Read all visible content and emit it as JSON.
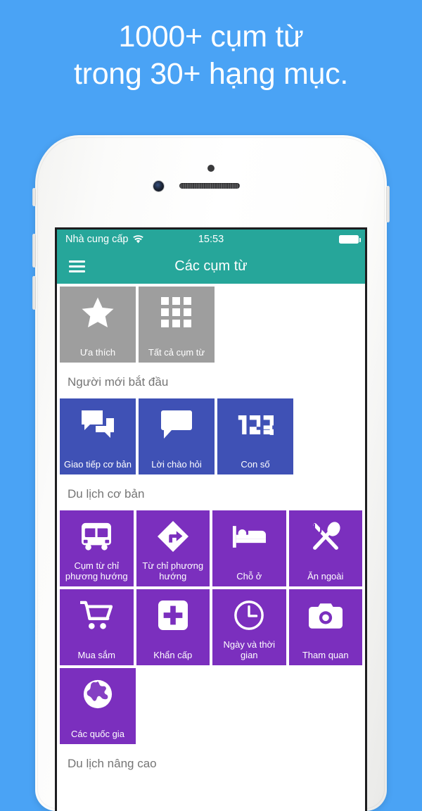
{
  "headline": "1000+ cụm từ\ntrong 30+ hạng mục.",
  "colors": {
    "background": "#4aa3f5",
    "header": "#26a69a",
    "gray_tile": "#9e9e9e",
    "blue_tile": "#3f51b5",
    "purple_tile": "#7b2fbe",
    "section_text": "#757575"
  },
  "statusbar": {
    "carrier": "Nhà cung cấp",
    "wifi_icon": "wifi-icon",
    "time": "15:53",
    "battery_icon": "battery-icon"
  },
  "navbar": {
    "menu_icon": "hamburger-menu-icon",
    "title": "Các cụm từ"
  },
  "sections": [
    {
      "title": "",
      "tiles": [
        {
          "label": "Ưa thích",
          "icon": "star-icon",
          "color": "gray"
        },
        {
          "label": "Tất cả cụm từ",
          "icon": "grid-icon",
          "color": "gray"
        }
      ]
    },
    {
      "title": "Người mới bắt đầu",
      "tiles": [
        {
          "label": "Giao tiếp cơ bản",
          "icon": "chat-bubbles-icon",
          "color": "blue"
        },
        {
          "label": "Lời chào hỏi",
          "icon": "chat-bubble-icon",
          "color": "blue"
        },
        {
          "label": "Con số",
          "icon": "numbers-123-icon",
          "color": "blue"
        }
      ]
    },
    {
      "title": "Du lịch cơ bản",
      "tiles": [
        {
          "label": "Cụm từ chỉ phương hướng",
          "icon": "bus-icon",
          "color": "purple"
        },
        {
          "label": "Từ chỉ phương hướng",
          "icon": "direction-sign-icon",
          "color": "purple"
        },
        {
          "label": "Chỗ ở",
          "icon": "bed-icon",
          "color": "purple"
        },
        {
          "label": "Ăn ngoài",
          "icon": "cutlery-icon",
          "color": "purple"
        },
        {
          "label": "Mua sắm",
          "icon": "shopping-cart-icon",
          "color": "purple"
        },
        {
          "label": "Khẩn cấp",
          "icon": "plus-cross-icon",
          "color": "purple"
        },
        {
          "label": "Ngày và thời gian",
          "icon": "clock-icon",
          "color": "purple"
        },
        {
          "label": "Tham quan",
          "icon": "camera-icon",
          "color": "purple"
        },
        {
          "label": "Các quốc gia",
          "icon": "globe-icon",
          "color": "purple"
        }
      ]
    },
    {
      "title": "Du lịch nâng cao",
      "tiles": []
    }
  ]
}
